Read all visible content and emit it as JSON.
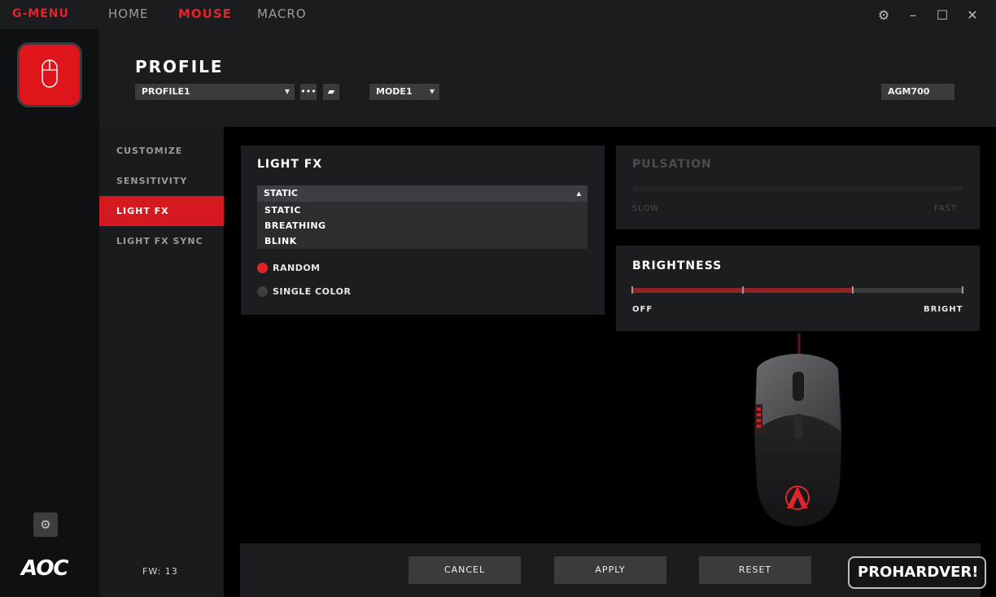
{
  "app": {
    "brand": "G-MENU",
    "nav_tabs": [
      {
        "label": "HOME",
        "active": false
      },
      {
        "label": "MOUSE",
        "active": true
      },
      {
        "label": "MACRO",
        "active": false
      }
    ],
    "accent_color": "#e2232a"
  },
  "header": {
    "title": "PROFILE",
    "profile_select": "PROFILE1",
    "mode_select": "MODE1",
    "device_name": "AGM700",
    "more_icon": "ellipsis-icon",
    "copy_icon": "copy-icon"
  },
  "sidebar": {
    "items": [
      {
        "label": "CUSTOMIZE",
        "active": false
      },
      {
        "label": "SENSITIVITY",
        "active": false
      },
      {
        "label": "LIGHT FX",
        "active": true
      },
      {
        "label": "LIGHT FX SYNC",
        "active": false
      }
    ],
    "firmware": "FW: 13"
  },
  "light_fx": {
    "title": "LIGHT FX",
    "selected": "STATIC",
    "options": [
      "STATIC",
      "BREATHING",
      "BLINK"
    ],
    "color_modes": [
      {
        "label": "RANDOM",
        "selected": true
      },
      {
        "label": "SINGLE COLOR",
        "selected": false
      }
    ]
  },
  "pulsation": {
    "title": "PULSATION",
    "min_label": "SLOW",
    "max_label": "FAST",
    "enabled": false
  },
  "brightness": {
    "title": "BRIGHTNESS",
    "min_label": "OFF",
    "max_label": "BRIGHT",
    "level": 0.67,
    "steps": 3
  },
  "footer": {
    "cancel": "CANCEL",
    "apply": "APPLY",
    "reset": "RESET"
  },
  "branding": {
    "logo": "AOC",
    "watermark": "PROHARDVER!"
  }
}
